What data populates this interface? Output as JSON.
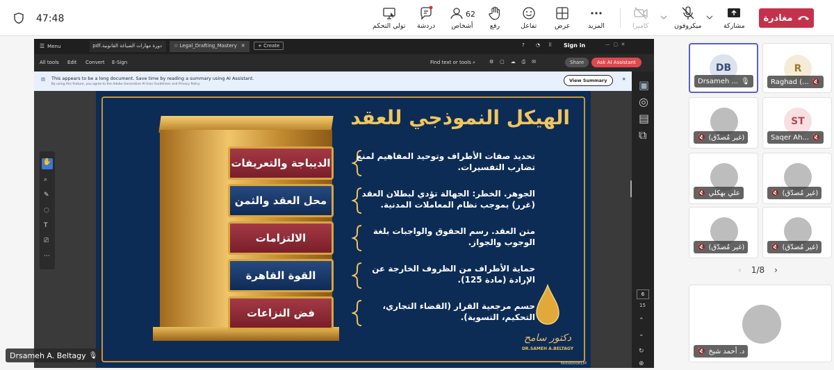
{
  "meeting": {
    "timer": "47:48",
    "leave_label": "مغادرة"
  },
  "toolbar": [
    {
      "id": "take-control",
      "label": "تولي التحكم",
      "icon": "screen-cursor-icon"
    },
    {
      "id": "chat",
      "label": "دردشة",
      "icon": "chat-icon"
    },
    {
      "id": "people",
      "label": "أشخاص",
      "count": "62",
      "icon": "people-icon"
    },
    {
      "id": "raise",
      "label": "رفع",
      "icon": "hand-icon"
    },
    {
      "id": "react",
      "label": "تفاعل",
      "icon": "smile-icon"
    },
    {
      "id": "view",
      "label": "عرض",
      "icon": "grid-icon"
    },
    {
      "id": "more",
      "label": "المزيد",
      "icon": "more-icon"
    },
    {
      "id": "camera",
      "label": "كاميرا",
      "icon": "camera-off-icon"
    },
    {
      "id": "mic",
      "label": "ميكروفون",
      "icon": "mic-off-icon"
    },
    {
      "id": "share",
      "label": "مشاركة",
      "icon": "share-icon"
    }
  ],
  "acrobat": {
    "menu_label": "Menu",
    "tab1": "دورة مهارات الصياغة القانونية.pdf",
    "tab2": "Legal_Drafting_Mastery",
    "create": "Create",
    "sign_in": "Sign in",
    "tools": [
      "All tools",
      "Edit",
      "Convert",
      "E-Sign"
    ],
    "find": "Find text or tools",
    "share": "Share",
    "ask_ai": "Ask AI Assistant",
    "banner_main": "This appears to be a long document. Save time by reading a summary using AI Assistant.",
    "banner_sub": "By using this feature, you agree to the Adobe Generative AI User Guidelines and Privacy Policy",
    "view_summary": "View Summary",
    "page_num": "6",
    "page_total": "15"
  },
  "slide": {
    "title": "الهيكل النموذجي للعقد",
    "items": [
      {
        "label": "الديباجة والتعريفات",
        "desc": "تحديد صفات الأطراف وتوحيد المفاهيم لمنع تضارب التفسيرات."
      },
      {
        "label": "محل العقد والثمن",
        "desc": "الجوهر. الخطر: الجهالة تؤدي لبطلان العقد (غرر) بموجب نظام المعاملات المدنية."
      },
      {
        "label": "الالتزامات",
        "desc": "متن العقد. رسم الحقوق والواجبات بلغة الوجوب والجواز."
      },
      {
        "label": "القوة القاهرة",
        "desc": "حماية الأطراف من الظروف الخارجة عن الإرادة (مادة 125)."
      },
      {
        "label": "فض النزاعات",
        "desc": "حسم مرجعية القرار (القضاء التجاري، التحكيم، التسوية)."
      }
    ],
    "signature": "دكتور سامح",
    "brand": "DR.SAMEH A.BELTAGY",
    "watermark": "NotebookLM"
  },
  "presenter": {
    "name": "Drsameh A. Beltagy"
  },
  "participants": [
    {
      "name": "Drsameh ...",
      "initials": "DB",
      "bg": "#dce3ef",
      "fg": "#3a4e74",
      "active": true
    },
    {
      "name": "Raghad (...",
      "initials": "R",
      "bg": "#f5ecd7",
      "fg": "#9a7b2c"
    },
    {
      "name": "(غير مُصدّق)",
      "initials": ""
    },
    {
      "name": "Saqer Ah...",
      "initials": "ST",
      "bg": "#f7dfe2",
      "fg": "#b34a5a"
    },
    {
      "name": "علي بهكلي",
      "initials": ""
    },
    {
      "name": "(غير مُصدّق)",
      "initials": ""
    },
    {
      "name": "(غير مُصدّق)",
      "initials": ""
    },
    {
      "name": "(غير مُصدّق)",
      "initials": ""
    }
  ],
  "pager": {
    "text": "1/8"
  },
  "extra_participant": {
    "name": "د. أحمد شيخ"
  }
}
